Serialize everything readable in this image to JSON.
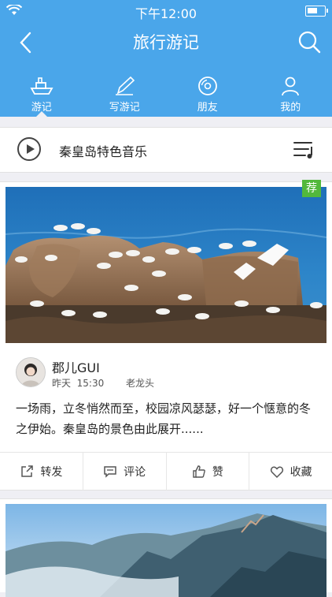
{
  "status_bar": {
    "time": "下午12:00"
  },
  "header": {
    "title": "旅行游记"
  },
  "tabs": [
    {
      "label": "游记",
      "icon": "ship-icon",
      "active": true
    },
    {
      "label": "写游记",
      "icon": "pen-icon"
    },
    {
      "label": "朋友",
      "icon": "disc-icon"
    },
    {
      "label": "我的",
      "icon": "person-icon"
    }
  ],
  "music": {
    "title": "秦皇岛特色音乐"
  },
  "post": {
    "badge": "荐",
    "image": "seagulls-on-rocks",
    "author": "郡儿GUI",
    "date": "昨天",
    "time": "15:30",
    "location": "老龙头",
    "text": "一场雨，立冬悄然而至，校园凉风瑟瑟，好一个惬意的冬之伊始。秦皇岛的景色由此展开......",
    "actions": [
      {
        "label": "转发",
        "icon": "share-icon"
      },
      {
        "label": "评论",
        "icon": "comment-icon"
      },
      {
        "label": "赞",
        "icon": "thumb-up-icon"
      },
      {
        "label": "收藏",
        "icon": "heart-icon"
      }
    ]
  },
  "post2": {
    "image": "mountain-landscape"
  },
  "colors": {
    "header_bg": "#4aa6ea",
    "badge_bg": "#52b83c",
    "page_bg": "#efeff4"
  }
}
